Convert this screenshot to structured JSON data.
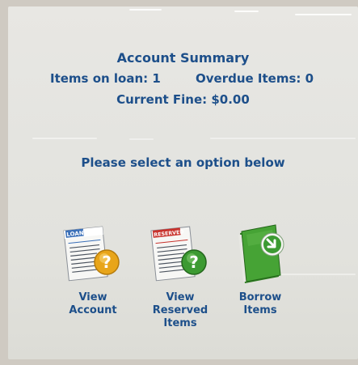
{
  "summary": {
    "title": "Account Summary",
    "items_on_loan": "Items on loan: 1",
    "overdue_items": "Overdue Items: 0",
    "current_fine": "Current Fine: $0.00"
  },
  "prompt": "Please select an option below",
  "options": [
    {
      "label": "View\nAccount",
      "icon": "loans-document-help-icon",
      "badge": "LOANS"
    },
    {
      "label": "View\nReserved\nItems",
      "icon": "reserved-document-help-icon",
      "badge": "RESERVED"
    },
    {
      "label": "Borrow\nItems",
      "icon": "green-book-arrow-icon"
    }
  ],
  "colors": {
    "text": "#1d4f8a",
    "loans_tab": "#3a6fb8",
    "reserved_tab": "#c8322c",
    "help_badge": "#e8a51a",
    "help_badge_green": "#3c9a32",
    "book_green": "#3f9a2e"
  }
}
